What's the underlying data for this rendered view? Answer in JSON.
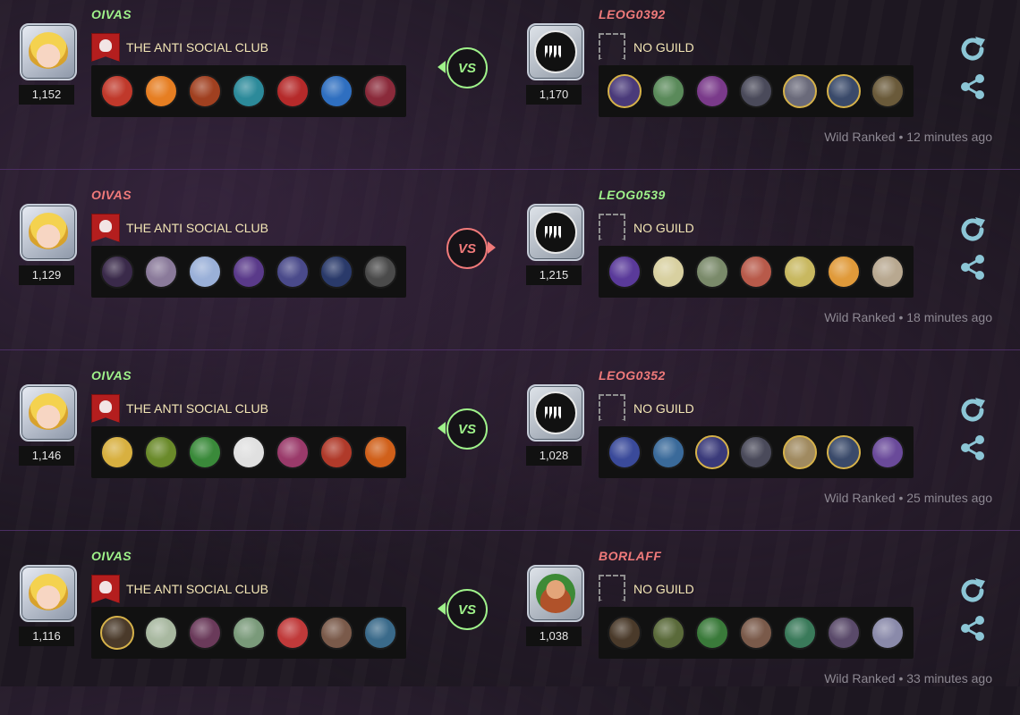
{
  "colors": {
    "win": "#9ff28a",
    "lose": "#f07a7a",
    "guild": "#f3e6b5",
    "accent_icon": "#8cc6d6"
  },
  "battles": [
    {
      "left": {
        "name": "OIVAS",
        "result": "win",
        "avatar": "princess-avatar",
        "rating": "1,152",
        "guild": "THE ANTI SOCIAL CLUB",
        "guild_icon": "skull-banner-icon",
        "cards": [
          {
            "c": "#c0392b",
            "g": false
          },
          {
            "c": "#e67e22",
            "g": false
          },
          {
            "c": "#a04020",
            "g": false
          },
          {
            "c": "#2c8a9a",
            "g": false
          },
          {
            "c": "#b52a2a",
            "g": false
          },
          {
            "c": "#2f6fc0",
            "g": false
          },
          {
            "c": "#8a2a3a",
            "g": false
          }
        ]
      },
      "vs_winner": "left",
      "right": {
        "name": "LEOG0392",
        "result": "lose",
        "avatar": "monster-avatar",
        "rating": "1,170",
        "guild": "NO GUILD",
        "guild_icon": "empty-banner-icon",
        "cards": [
          {
            "c": "#4a3a7a",
            "g": true
          },
          {
            "c": "#5a8a5a",
            "g": false
          },
          {
            "c": "#7a3a8a",
            "g": false
          },
          {
            "c": "#4a4a5a",
            "g": false
          },
          {
            "c": "#6a6a7a",
            "g": true
          },
          {
            "c": "#3a4a6a",
            "g": true
          },
          {
            "c": "#6a5a3a",
            "g": false
          }
        ]
      },
      "meta": "Wild Ranked • 12 minutes ago"
    },
    {
      "left": {
        "name": "OIVAS",
        "result": "lose",
        "avatar": "princess-avatar",
        "rating": "1,129",
        "guild": "THE ANTI SOCIAL CLUB",
        "guild_icon": "skull-banner-icon",
        "cards": [
          {
            "c": "#3a2a4a",
            "g": false
          },
          {
            "c": "#8a7a9a",
            "g": false
          },
          {
            "c": "#9ab0d8",
            "g": false
          },
          {
            "c": "#5a3a8a",
            "g": false
          },
          {
            "c": "#4a4a8a",
            "g": false
          },
          {
            "c": "#2a3a6a",
            "g": false
          },
          {
            "c": "#4a4a4a",
            "g": false
          }
        ]
      },
      "vs_winner": "right",
      "right": {
        "name": "LEOG0539",
        "result": "win",
        "avatar": "monster-avatar",
        "rating": "1,215",
        "guild": "NO GUILD",
        "guild_icon": "empty-banner-icon",
        "cards": [
          {
            "c": "#5a3a9a",
            "g": false
          },
          {
            "c": "#d8d0a0",
            "g": false
          },
          {
            "c": "#7a8a6a",
            "g": false
          },
          {
            "c": "#b85a4a",
            "g": false
          },
          {
            "c": "#c8b860",
            "g": false
          },
          {
            "c": "#e09a3a",
            "g": false
          },
          {
            "c": "#b8a890",
            "g": false
          }
        ]
      },
      "meta": "Wild Ranked • 18 minutes ago"
    },
    {
      "left": {
        "name": "OIVAS",
        "result": "win",
        "avatar": "princess-avatar",
        "rating": "1,146",
        "guild": "THE ANTI SOCIAL CLUB",
        "guild_icon": "skull-banner-icon",
        "cards": [
          {
            "c": "#d8b040",
            "g": false
          },
          {
            "c": "#6a8a2a",
            "g": false
          },
          {
            "c": "#3a8a3a",
            "g": false
          },
          {
            "c": "#e0e0e0",
            "g": false
          },
          {
            "c": "#9a3a6a",
            "g": false
          },
          {
            "c": "#b03a2a",
            "g": false
          },
          {
            "c": "#d0601a",
            "g": false
          }
        ]
      },
      "vs_winner": "left",
      "right": {
        "name": "LEOG0352",
        "result": "lose",
        "avatar": "monster-avatar",
        "rating": "1,028",
        "guild": "NO GUILD",
        "guild_icon": "empty-banner-icon",
        "cards": [
          {
            "c": "#3a4a9a",
            "g": false
          },
          {
            "c": "#3a6a9a",
            "g": false
          },
          {
            "c": "#3a3a7a",
            "g": true
          },
          {
            "c": "#4a4a5a",
            "g": false
          },
          {
            "c": "#a08a60",
            "g": true
          },
          {
            "c": "#3a4a6a",
            "g": true
          },
          {
            "c": "#6a4a9a",
            "g": false
          }
        ]
      },
      "meta": "Wild Ranked • 25 minutes ago"
    },
    {
      "left": {
        "name": "OIVAS",
        "result": "win",
        "avatar": "princess-avatar",
        "rating": "1,116",
        "guild": "THE ANTI SOCIAL CLUB",
        "guild_icon": "skull-banner-icon",
        "cards": [
          {
            "c": "#4a3a2a",
            "g": true
          },
          {
            "c": "#a8b8a0",
            "g": false
          },
          {
            "c": "#6a3a5a",
            "g": false
          },
          {
            "c": "#7a9a7a",
            "g": false
          },
          {
            "c": "#c03a3a",
            "g": false
          },
          {
            "c": "#7a5a4a",
            "g": false
          },
          {
            "c": "#3a6a8a",
            "g": false
          }
        ]
      },
      "vs_winner": "left",
      "right": {
        "name": "BORLAFF",
        "result": "lose",
        "avatar": "bearded-avatar",
        "rating": "1,038",
        "guild": "NO GUILD",
        "guild_icon": "empty-banner-icon",
        "cards": [
          {
            "c": "#4a3a2a",
            "g": false
          },
          {
            "c": "#5a6a3a",
            "g": false
          },
          {
            "c": "#3a7a3a",
            "g": false
          },
          {
            "c": "#7a5a4a",
            "g": false
          },
          {
            "c": "#3a7a5a",
            "g": false
          },
          {
            "c": "#5a4a6a",
            "g": false
          },
          {
            "c": "#8a8aaa",
            "g": false
          }
        ]
      },
      "meta": "Wild Ranked • 33 minutes ago"
    }
  ],
  "labels": {
    "vs": "VS"
  }
}
